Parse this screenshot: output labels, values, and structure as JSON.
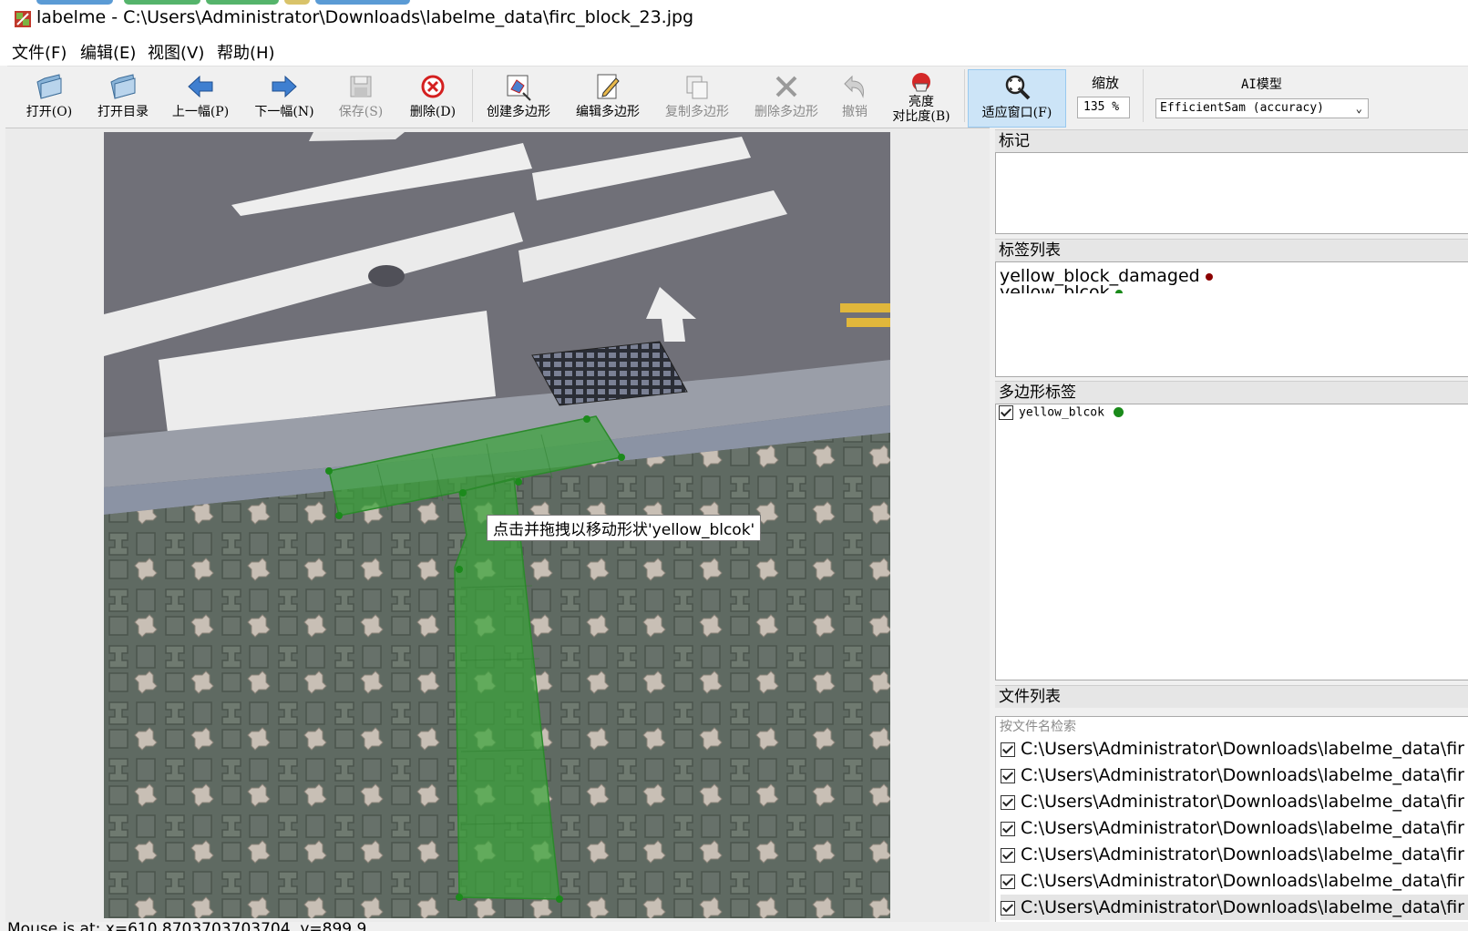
{
  "window": {
    "title": "labelme - C:\\Users\\Administrator\\Downloads\\labelme_data\\firc_block_23.jpg"
  },
  "menu": [
    "文件(F)",
    "编辑(E)",
    "视图(V)",
    "帮助(H)"
  ],
  "toolbar": {
    "open": "打开(O)",
    "open_dir": "打开目录",
    "prev": "上一幅(P)",
    "next": "下一幅(N)",
    "save": "保存(S)",
    "delete": "删除(D)",
    "create_polygon": "创建多边形",
    "edit_polygon": "编辑多边形",
    "copy_polygon": "复制多边形",
    "delete_polygon": "删除多边形",
    "undo": "撤销",
    "brightness_1": "亮度",
    "brightness_2": "对比度(B)",
    "fit_window": "适应窗口(F)",
    "zoom_label": "缩放",
    "zoom_value": "135 %",
    "ai_label": "AI模型",
    "ai_model": "EfficientSam (accuracy)"
  },
  "canvas": {
    "tooltip": "点击并拖拽以移动形状'yellow_blcok'"
  },
  "docks": {
    "flags_title": "标记",
    "labels_title": "标签列表",
    "labels": [
      {
        "name": "yellow_block_damaged",
        "color": "#8b0000"
      },
      {
        "name": "yellow_blcok",
        "color": "#1a8a1a"
      }
    ],
    "polygons_title": "多边形标签",
    "polygons": [
      {
        "name": "yellow_blcok",
        "color": "#1a8a1a",
        "checked": true
      }
    ],
    "files_title": "文件列表",
    "file_search_placeholder": "按文件名检索",
    "files": [
      "C:\\Users\\Administrator\\Downloads\\labelme_data\\fir",
      "C:\\Users\\Administrator\\Downloads\\labelme_data\\fir",
      "C:\\Users\\Administrator\\Downloads\\labelme_data\\fir",
      "C:\\Users\\Administrator\\Downloads\\labelme_data\\fir",
      "C:\\Users\\Administrator\\Downloads\\labelme_data\\fir",
      "C:\\Users\\Administrator\\Downloads\\labelme_data\\fir",
      "C:\\Users\\Administrator\\Downloads\\labelme_data\\fir"
    ]
  },
  "status": {
    "text": "Mouse is at: x=610.8703703703704, y=899.9"
  },
  "colors": {
    "polygon_fill": "#3aa33a",
    "polygon_vertex": "#1c8a1c",
    "label_damaged": "#8b0000",
    "label_ok": "#1a8a1a"
  }
}
